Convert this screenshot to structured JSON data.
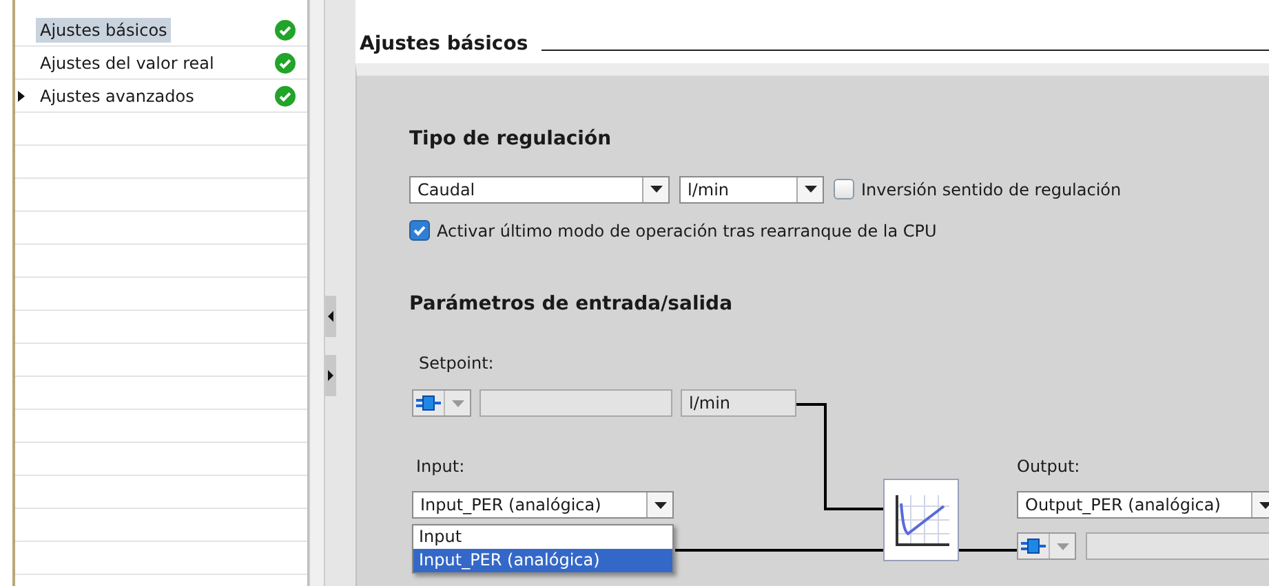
{
  "sidebar": {
    "items": [
      {
        "label": "Ajustes básicos",
        "selected": true,
        "kind": "item"
      },
      {
        "label": "Ajustes del valor real",
        "selected": false,
        "kind": "item"
      },
      {
        "label": "Ajustes avanzados",
        "selected": false,
        "kind": "group"
      }
    ]
  },
  "header": {
    "title": "Ajustes básicos"
  },
  "regulation": {
    "title": "Tipo de regulación",
    "type_dropdown": {
      "value": "Caudal"
    },
    "unit_dropdown": {
      "value": "l/min"
    },
    "checkboxes": [
      {
        "label": "Inversión sentido de regulación",
        "checked": false
      },
      {
        "label": "Activar último modo de operación tras rearranque de la CPU",
        "checked": true
      }
    ]
  },
  "io": {
    "title": "Parámetros de entrada/salida",
    "setpoint": {
      "label": "Setpoint:",
      "unit": "l/min"
    },
    "input": {
      "label": "Input:",
      "value": "Input_PER (analógica)",
      "options": [
        {
          "label": "Input",
          "selected": false
        },
        {
          "label": "Input_PER (analógica)",
          "selected": true
        }
      ]
    },
    "output": {
      "label": "Output:",
      "value": "Output_PER (analógica)"
    }
  }
}
